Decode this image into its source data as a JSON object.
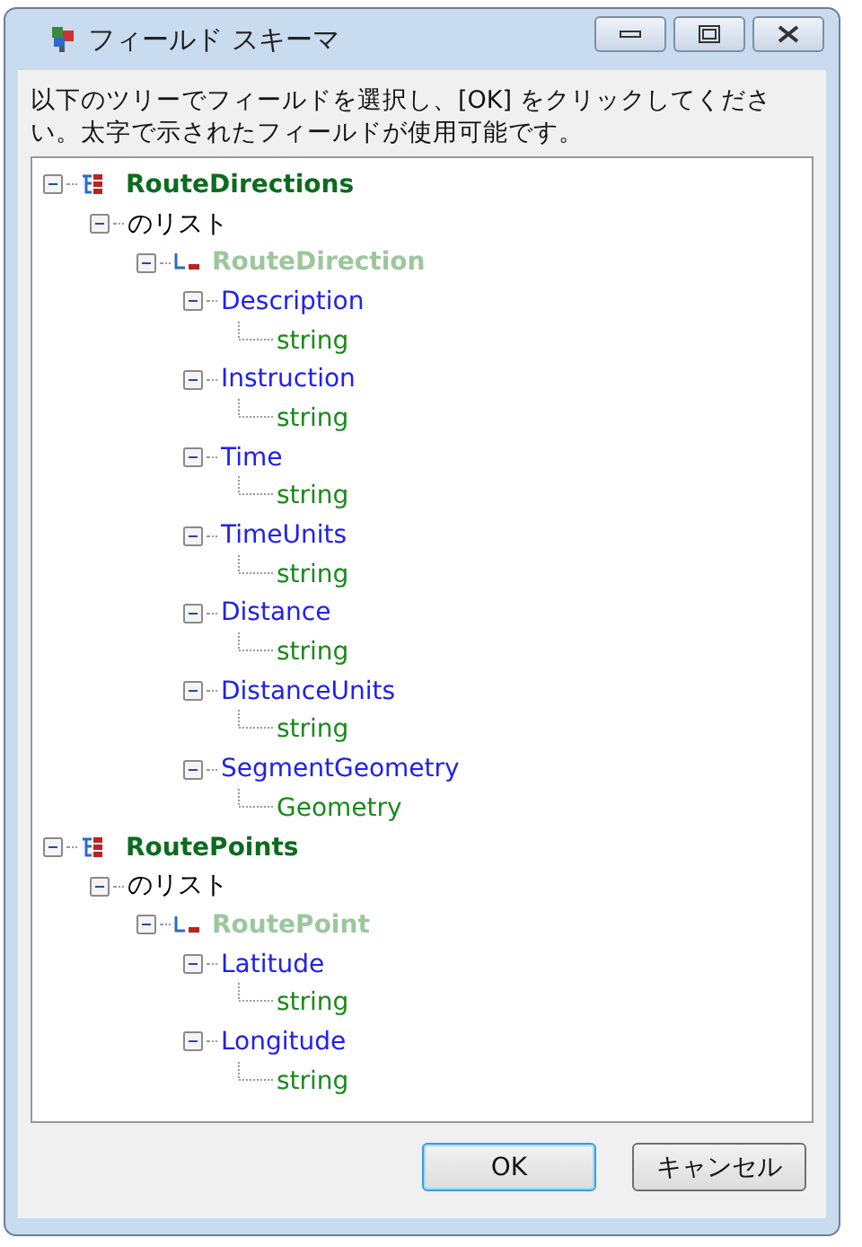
{
  "window": {
    "title": "フィールド スキーマ"
  },
  "instruction": "以下のツリーでフィールドを選択し、[OK] をクリックしてください。太字で示されたフィールドが使用可能です。",
  "tree": [
    {
      "kind": "root",
      "label": "RouteDirections",
      "expanded": true,
      "children": [
        {
          "kind": "list",
          "label": "のリスト",
          "expanded": true,
          "children": [
            {
              "kind": "element",
              "label": "RouteDirection",
              "expanded": true,
              "children": [
                {
                  "kind": "field",
                  "label": "Description",
                  "expanded": true,
                  "children": [
                    {
                      "kind": "type",
                      "label": "string"
                    }
                  ]
                },
                {
                  "kind": "field",
                  "label": "Instruction",
                  "expanded": true,
                  "children": [
                    {
                      "kind": "type",
                      "label": "string"
                    }
                  ]
                },
                {
                  "kind": "field",
                  "label": "Time",
                  "expanded": true,
                  "children": [
                    {
                      "kind": "type",
                      "label": "string"
                    }
                  ]
                },
                {
                  "kind": "field",
                  "label": "TimeUnits",
                  "expanded": true,
                  "children": [
                    {
                      "kind": "type",
                      "label": "string"
                    }
                  ]
                },
                {
                  "kind": "field",
                  "label": "Distance",
                  "expanded": true,
                  "children": [
                    {
                      "kind": "type",
                      "label": "string"
                    }
                  ]
                },
                {
                  "kind": "field",
                  "label": "DistanceUnits",
                  "expanded": true,
                  "children": [
                    {
                      "kind": "type",
                      "label": "string"
                    }
                  ]
                },
                {
                  "kind": "field",
                  "label": "SegmentGeometry",
                  "expanded": true,
                  "children": [
                    {
                      "kind": "type",
                      "label": "Geometry"
                    }
                  ]
                }
              ]
            }
          ]
        }
      ]
    },
    {
      "kind": "root",
      "label": "RoutePoints",
      "expanded": true,
      "children": [
        {
          "kind": "list",
          "label": "のリスト",
          "expanded": true,
          "children": [
            {
              "kind": "element",
              "label": "RoutePoint",
              "expanded": true,
              "children": [
                {
                  "kind": "field",
                  "label": "Latitude",
                  "expanded": true,
                  "children": [
                    {
                      "kind": "type",
                      "label": "string"
                    }
                  ]
                },
                {
                  "kind": "field",
                  "label": "Longitude",
                  "expanded": true,
                  "children": [
                    {
                      "kind": "type",
                      "label": "string"
                    }
                  ]
                }
              ]
            }
          ]
        }
      ]
    }
  ],
  "buttons": [
    {
      "label": "OK",
      "default": true
    },
    {
      "label": "キャンセル",
      "default": false
    }
  ]
}
